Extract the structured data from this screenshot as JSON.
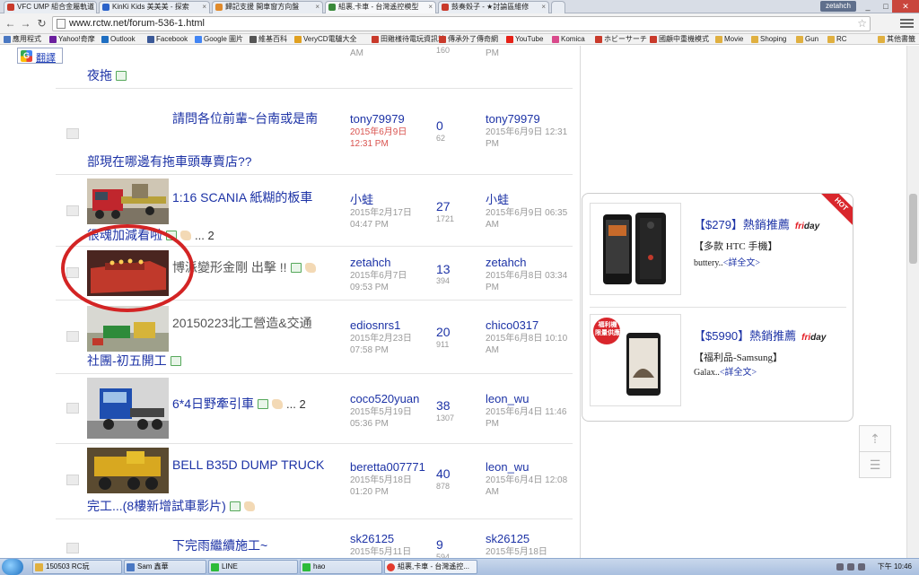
{
  "browser": {
    "tabs": [
      {
        "title": "VFC UMP 組合金屬軌道",
        "color": "#c93a2b"
      },
      {
        "title": "KinKi Kids 美美美 - 探索",
        "color": "#2a62c9"
      },
      {
        "title": "歸記支援 開車窗方向盤",
        "color": "#e08a2b"
      },
      {
        "title": "組裹,卡車 - 台灣遙控模型",
        "color": "#3a8a3a"
      },
      {
        "title": "鼓奏殼子 - ★討論區維修",
        "color": "#c93a2b"
      }
    ],
    "user": "zetahch",
    "url": "www.rctw.net/forum-536-1.html",
    "bookmarks": [
      {
        "label": "應用程式",
        "color": "#4a78c2"
      },
      {
        "label": "Yahoo!奇摩",
        "color": "#6b1f9e"
      },
      {
        "label": "Outlook",
        "color": "#1f6fc2"
      },
      {
        "label": "Facebook",
        "color": "#3b5998"
      },
      {
        "label": "Google 圖片",
        "color": "#4285f4"
      },
      {
        "label": "維基百科",
        "color": "#555555"
      },
      {
        "label": "VeryCD電驢大全",
        "color": "#e0a020"
      },
      {
        "label": "田雞樣待電玩資訊站",
        "color": "#c93a2b"
      },
      {
        "label": "傳承外了傳奇網",
        "color": "#c93a2b"
      },
      {
        "label": "YouTube",
        "color": "#e62117"
      },
      {
        "label": "Komica",
        "color": "#d94a8c"
      },
      {
        "label": "ホビーサーチ",
        "color": "#c93a2b"
      },
      {
        "label": "國顧中重機模式",
        "color": "#c93a2b"
      },
      {
        "label": "Movie",
        "color": "#e0b040"
      },
      {
        "label": "Shoping",
        "color": "#e0b040"
      },
      {
        "label": "Gun",
        "color": "#e0b040"
      },
      {
        "label": "RC",
        "color": "#e0b040"
      },
      {
        "label": "其他書籤",
        "color": "#e0b040"
      }
    ]
  },
  "translate_label": "翻譯",
  "forum": {
    "top_partial": {
      "author_time": "AM",
      "views": "160",
      "last_time": "PM",
      "title_line2": "夜拖"
    },
    "threads": [
      {
        "title_line1": "請問各位前輩~台南或是南",
        "title_line2": "部現在哪邊有拖車頭專賣店??",
        "author": "tony79979",
        "author_date": "2015年6月9日 12:31 PM",
        "replies": "0",
        "views": "62",
        "last_poster": "tony79979",
        "last_date": "2015年6月9日 12:31 PM"
      },
      {
        "title_line1": "1:16 SCANIA 紙糊的板車",
        "title_line2": "很魂加減看啦",
        "pages": "... 2",
        "author": "小蛙",
        "author_date": "2015年2月17日 04:47 PM",
        "replies": "27",
        "views": "1721",
        "last_poster": "小蛙",
        "last_date": "2015年6月9日 06:35 AM"
      },
      {
        "title_line1": "博派變形金剛 出擊 !!",
        "author": "zetahch",
        "author_date": "2015年6月7日 09:53 PM",
        "replies": "13",
        "views": "394",
        "last_poster": "zetahch",
        "last_date": "2015年6月8日 03:34 PM"
      },
      {
        "title_line1": "20150223北工營造&交通",
        "title_line2": "社團-初五開工",
        "author": "ediosnrs1",
        "author_date": "2015年2月23日 07:58 PM",
        "replies": "20",
        "views": "911",
        "last_poster": "chico0317",
        "last_date": "2015年6月8日 10:10 AM"
      },
      {
        "title_line1": "6*4日野牽引車",
        "pages": "... 2",
        "author": "coco520yuan",
        "author_date": "2015年5月19日 05:36 PM",
        "replies": "38",
        "views": "1307",
        "last_poster": "leon_wu",
        "last_date": "2015年6月4日 11:46 PM"
      },
      {
        "title_line1": "BELL B35D DUMP TRUCK",
        "title_line2": "完工...(8樓新增試車影片)",
        "author": "beretta007771",
        "author_date": "2015年5月18日 01:20 PM",
        "replies": "40",
        "views": "878",
        "last_poster": "leon_wu",
        "last_date": "2015年6月4日 12:08 AM"
      },
      {
        "title_line1": "下完雨繼續施工~",
        "author": "sk26125",
        "author_date": "2015年5月11日",
        "replies": "9",
        "views": "594",
        "last_poster": "sk26125",
        "last_date": "2015年5月18日"
      }
    ]
  },
  "ads": [
    {
      "price": "【$279】熱銷推薦",
      "brand_a": "fri",
      "brand_b": "day",
      "name": "【多款 HTC 手機】",
      "desc": "buttery..",
      "more": "<詳全文>",
      "badge": "HOT"
    },
    {
      "price": "【$5990】熱銷推薦",
      "brand_a": "fri",
      "brand_b": "day",
      "name": "【福利品-Samsung】",
      "desc": "Galax..",
      "more": "<詳全文>",
      "badge_text": "福利機 限量供應"
    }
  ],
  "taskbar": {
    "items": [
      {
        "label": "150503 RC玩",
        "color": "#e0b040"
      },
      {
        "label": "Sam 鑫華",
        "color": "#4a78c2"
      },
      {
        "label": "LINE",
        "color": "#2dbb3a"
      },
      {
        "label": "hao",
        "color": "#2dbb3a"
      },
      {
        "label": "組裹,卡車 - 台灣遙控...",
        "color": "#e33b2e"
      }
    ],
    "clock": "下午 10:46"
  },
  "colors": {
    "link": "#1d33a6",
    "highlight_circle": "#d32424"
  }
}
